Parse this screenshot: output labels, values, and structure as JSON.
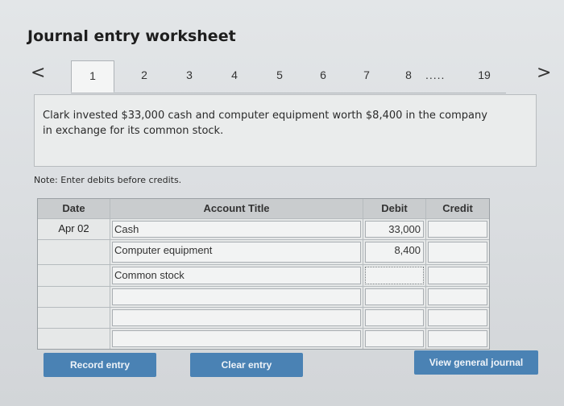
{
  "header": {
    "title": "Journal entry worksheet"
  },
  "nav": {
    "prev_icon": "chevron-left-icon",
    "next_icon": "chevron-right-icon",
    "prev_glyph": "<",
    "next_glyph": ">",
    "tabs": [
      "1",
      "2",
      "3",
      "4",
      "5",
      "6",
      "7",
      "8"
    ],
    "ellipsis": ".....",
    "last_tab": "19",
    "active_tab": "1"
  },
  "transaction": {
    "text": "Clark invested $33,000 cash and computer equipment worth $8,400 in the company in exchange for its common stock."
  },
  "note": "Note: Enter debits before credits.",
  "journal": {
    "columns": {
      "date": "Date",
      "account": "Account Title",
      "debit": "Debit",
      "credit": "Credit"
    },
    "rows": [
      {
        "date": "Apr 02",
        "account": "Cash",
        "debit": "33,000",
        "credit": ""
      },
      {
        "date": "",
        "account": "Computer equipment",
        "debit": "8,400",
        "credit": ""
      },
      {
        "date": "",
        "account": "Common stock",
        "debit": "",
        "credit": ""
      },
      {
        "date": "",
        "account": "",
        "debit": "",
        "credit": ""
      },
      {
        "date": "",
        "account": "",
        "debit": "",
        "credit": ""
      },
      {
        "date": "",
        "account": "",
        "debit": "",
        "credit": ""
      }
    ]
  },
  "buttons": {
    "record": "Record entry",
    "clear": "Clear entry",
    "view": "View general journal"
  },
  "colors": {
    "button": "#4a82b4",
    "header_row": "#c9ccce"
  }
}
